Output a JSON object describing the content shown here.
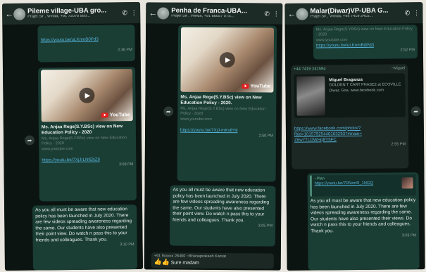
{
  "phones": [
    {
      "title": "Pileme village-UBA gro...",
      "subtitle": "Prajel Sir , Vrinda, +91 72076 993...",
      "icons": {
        "back": "back-arrow-icon",
        "avatar": "group-avatar-icon",
        "call": "add-call-icon",
        "menu": "more-vert-icon"
      },
      "top_link": "https://youtu.be/uLKnmB0Pd3",
      "top_time": "2:36 PM",
      "video_title": "Ms. Anjaa Rege(S.Y.BSc) view on New Education Policy - 2020",
      "video_caption": "Ms. Anjaa Rege(S.Y.BSc) view on New Education Policy - 2020",
      "video_site": "www.youtube.com",
      "video_link": "https://youtu.be/7XjJrLNtEbZ8",
      "video_time": "3:08 PM",
      "thumb_badge": "YouTube",
      "message": "As you all must be aware that new education policy has been launched in July 2020. There are few videos spreading awareness regarding the same. Our students have also presented their point  view. Do watch n pass this to your friends and colleagues. Thank you.",
      "message_time": "3:10 PM"
    },
    {
      "title": "Penha de Franca-UBA...",
      "subtitle": "Prajel Sir , Vrinda, +91 86057 07S...",
      "icons": {
        "back": "back-arrow-icon",
        "avatar": "group-avatar-icon",
        "call": "add-call-icon",
        "menu": "more-vert-icon"
      },
      "thumb_badge": "YouTube",
      "video_title": "Ms. Anjaa Rege(S.Y.BSc) view on New Education Policy - 2020.",
      "video_caption": "Ms. Anjaa Rege(S.Y.BSc) view on New Education Policy - 2020",
      "video_site": "www.youtube.com",
      "video_link": "https://youtu.be/7XjJ-mKv8Y8",
      "video_time": "2:50 PM",
      "message": "As you all must be aware that new education policy has been launched in July 2020. There are few videos spreading awareness regarding the same. Our students have also presented their point  view. Do watch n pass this to your friends and colleagues. Thank you.",
      "message_time": "3:05 PM",
      "reply_sender": "+91 9xxxxx 26400 ~Bhanuprakash Kamat",
      "reply_emoji": "👍👍",
      "reply_text": "Sure madam"
    },
    {
      "title": "Malar(Diwar)VP-UBA G...",
      "subtitle": "Prajel Sir , Vrinda, +44 7419 2415...",
      "icons": {
        "back": "back-arrow-icon",
        "avatar": "group-avatar-icon",
        "call": "add-call-icon",
        "menu": "more-vert-icon"
      },
      "top_text": "Ms. Anjaa Rege(S.Y.BSc) view on New Education Policy - 2020",
      "top_site": "www.youtube.com",
      "top_link": "https://youtu.be/uLKnmB0Pd3",
      "top_time": "2:52 PM",
      "fb_sender": "+44 7419 241594",
      "fb_sender_name": "~Miguel",
      "fb_title": "Miguel Braganza",
      "fb_caption": "GOLDEN T CART PHASE2 at ECOVILLE Diwar, Goa. www.facebook.com",
      "fb_link": "https://www.facebook.com/photo/?fbid=101579254401032937#main=",
      "fb_link2": "Z6w7TLDWHq8Y5FC",
      "fb_time": "2:55 PM",
      "reply_small": "~Plan",
      "reply_link": "https://youtu.be/7R5xmR_1NGQ",
      "message": "As you all must be aware that new education policy has been launched in July 2020. There are few videos spreading awareness regarding the same. Our students have also presented their views. Do watch n pass this to your friends and colleagues. Thank you.",
      "message_time": "3:03 PM"
    }
  ]
}
